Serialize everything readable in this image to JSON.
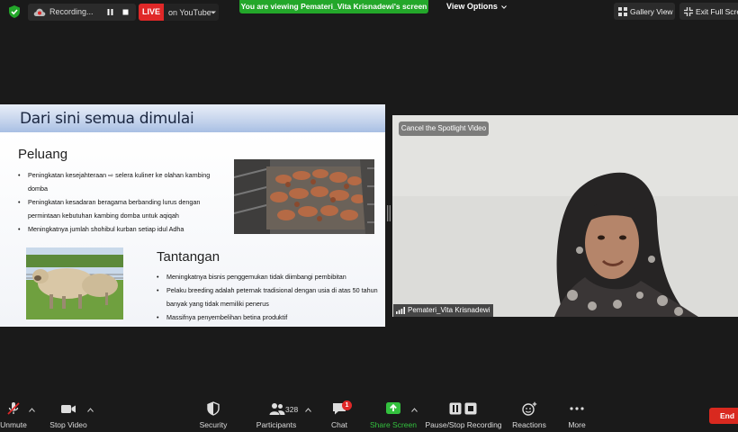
{
  "topbar": {
    "recording_label": "Recording...",
    "live_badge": "LIVE",
    "live_target": "on YouTube",
    "viewing_banner": "You are viewing Pemateri_Vita Krisnadewi's screen",
    "view_options": "View Options",
    "gallery_view": "Gallery View",
    "exit_fullscreen": "Exit Full Screen"
  },
  "slide": {
    "title": "Dari sini semua dimulai",
    "peluang_heading": "Peluang",
    "peluang_items": [
      "Peningkatan kesejahteraan ⇨ selera kuliner ke olahan kambing domba",
      "Peningkatan kesadaran beragama berbanding lurus dengan permintaan kebutuhan kambing domba untuk aqiqah",
      "Meningkatnya jumlah shohibul kurban setiap idul Adha"
    ],
    "tantangan_heading": "Tantangan",
    "tantangan_items": [
      "Meningkatnya bisnis penggemukan tidak diimbangi pembibitan",
      "Pelaku breeding adalah peternak tradisional dengan usia di atas 50 tahun banyak yang tidak memiliki penerus",
      "Massifnya penyembelihan betina produktif"
    ]
  },
  "video": {
    "cancel_spotlight": "Cancel the Spotlight Video",
    "participant_name": "Pemateri_Vita Krisnadewi"
  },
  "toolbar": {
    "unmute": "Unmute",
    "stop_video": "Stop Video",
    "security": "Security",
    "participants": "Participants",
    "participants_count": "328",
    "chat": "Chat",
    "chat_badge": "1",
    "share_screen": "Share Screen",
    "pause_stop_recording": "Pause/Stop Recording",
    "reactions": "Reactions",
    "more": "More",
    "end": "End"
  },
  "colors": {
    "background": "#1a1a1a",
    "live_red": "#e02828",
    "share_green": "#33c13e",
    "banner_green": "#23a72a",
    "end_red": "#d9291f"
  }
}
